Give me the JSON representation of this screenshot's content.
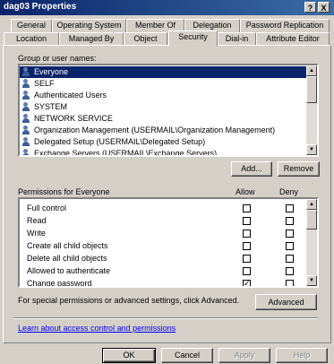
{
  "window": {
    "title": "dag03 Properties",
    "help_btn": "?",
    "close_btn": "X"
  },
  "tabs_row1": [
    "General",
    "Operating System",
    "Member Of",
    "Delegation",
    "Password Replication"
  ],
  "tabs_row2": [
    "Location",
    "Managed By",
    "Object",
    "Security",
    "Dial-in",
    "Attribute Editor"
  ],
  "active_tab": "Security",
  "groups": {
    "label": "Group or user names:",
    "items": [
      "Everyone",
      "SELF",
      "Authenticated Users",
      "SYSTEM",
      "NETWORK SERVICE",
      "Organization Management (USERMAIL\\Organization Management)",
      "Delegated Setup (USERMAIL\\Delegated Setup)",
      "Exchange Servers (USERMAIL\\Exchange Servers)"
    ],
    "selected": "Everyone"
  },
  "buttons": {
    "add": "Add...",
    "remove": "Remove",
    "advanced": "Advanced",
    "ok": "OK",
    "cancel": "Cancel",
    "apply": "Apply",
    "help": "Help"
  },
  "permissions": {
    "label": "Permissions for Everyone",
    "allow_header": "Allow",
    "deny_header": "Deny",
    "rows": [
      {
        "name": "Full control",
        "allow": false,
        "deny": false
      },
      {
        "name": "Read",
        "allow": false,
        "deny": false
      },
      {
        "name": "Write",
        "allow": false,
        "deny": false
      },
      {
        "name": "Create all child objects",
        "allow": false,
        "deny": false
      },
      {
        "name": "Delete all child objects",
        "allow": false,
        "deny": false
      },
      {
        "name": "Allowed to authenticate",
        "allow": false,
        "deny": false
      },
      {
        "name": "Change password",
        "allow": true,
        "deny": false
      }
    ]
  },
  "advanced_text": "For special permissions or advanced settings, click Advanced.",
  "learn_link": "Learn about access control and permissions",
  "colors": {
    "selection": "#0a246a",
    "face": "#d4d0c8",
    "title_start": "#0a246a",
    "title_end": "#3a6ea5",
    "link": "#0000ff"
  }
}
